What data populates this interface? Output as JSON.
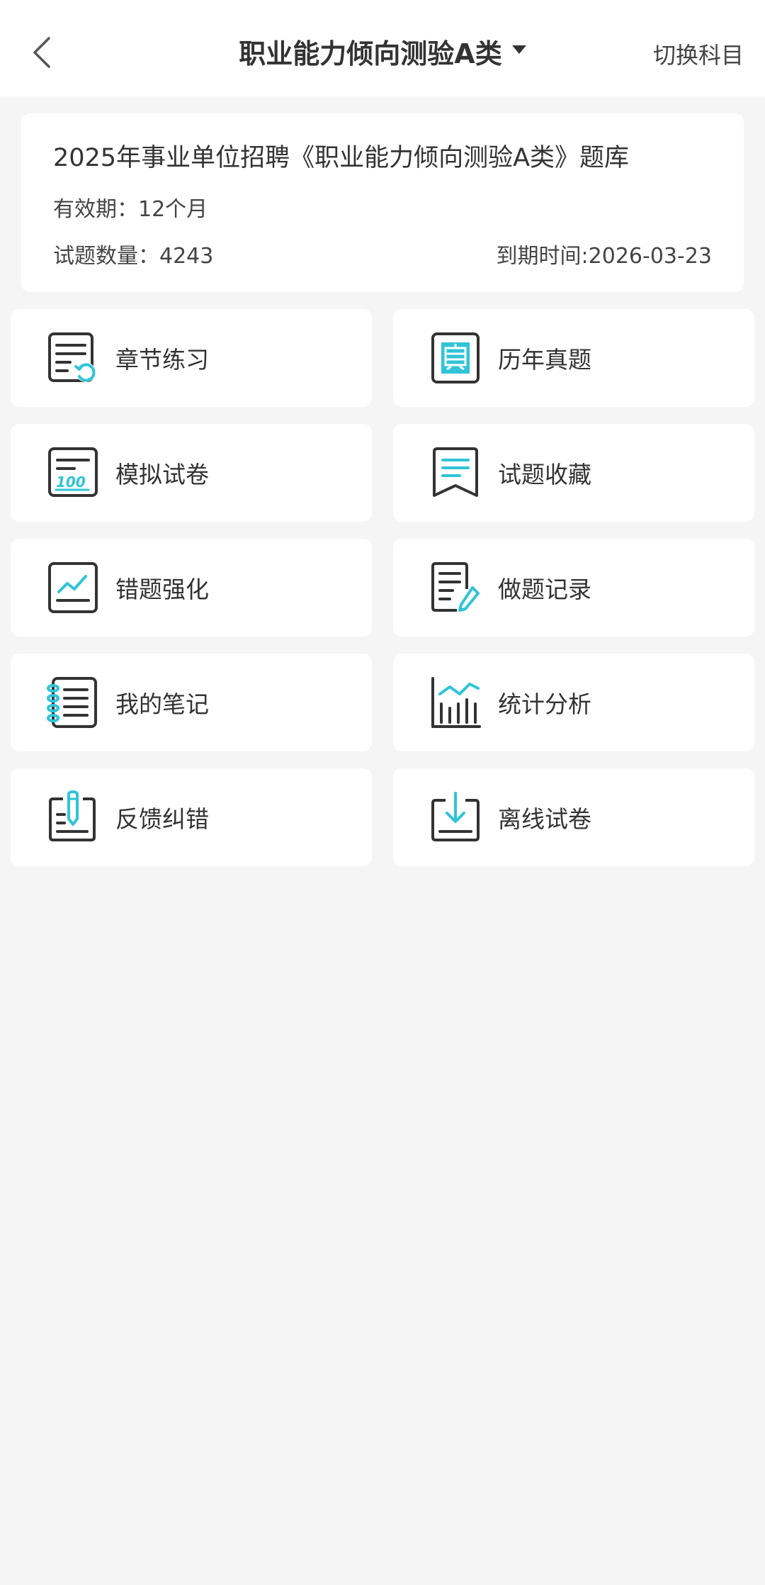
{
  "header": {
    "title": "职业能力倾向测验A类",
    "switch_label": "切换科目"
  },
  "info": {
    "title": "2025年事业单位招聘《职业能力倾向测验A类》题库",
    "validity": "有效期：12个月",
    "question_count": "试题数量：4243",
    "expiry": "到期时间:2026-03-23"
  },
  "menu": [
    {
      "label": "章节练习",
      "icon": "chapter-practice-icon"
    },
    {
      "label": "历年真题",
      "icon": "past-exam-icon"
    },
    {
      "label": "模拟试卷",
      "icon": "mock-exam-icon"
    },
    {
      "label": "试题收藏",
      "icon": "favorites-icon"
    },
    {
      "label": "错题强化",
      "icon": "wrong-question-icon"
    },
    {
      "label": "做题记录",
      "icon": "practice-record-icon"
    },
    {
      "label": "我的笔记",
      "icon": "notes-icon"
    },
    {
      "label": "统计分析",
      "icon": "statistics-icon"
    },
    {
      "label": "反馈纠错",
      "icon": "feedback-icon"
    },
    {
      "label": "离线试卷",
      "icon": "offline-download-icon"
    }
  ],
  "colors": {
    "accent": "#2fc4d8",
    "icon_stroke": "#333333",
    "background": "#f5f5f5"
  }
}
